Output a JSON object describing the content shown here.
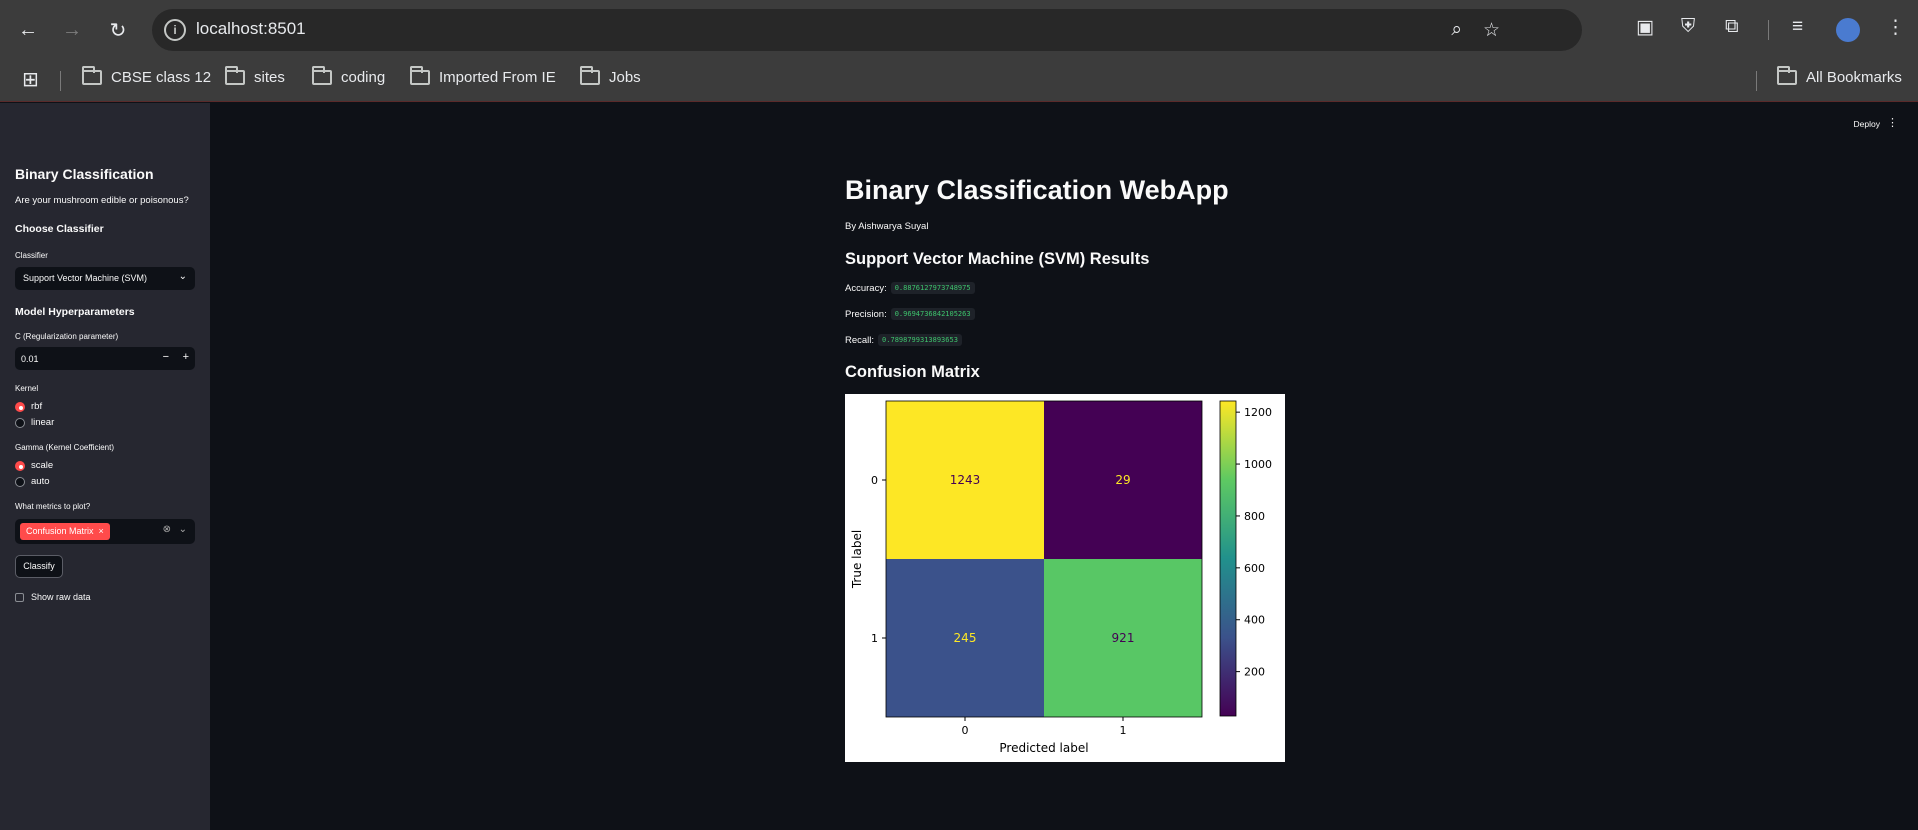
{
  "browser": {
    "url": "localhost:8501",
    "bookmarks": [
      "CBSE class 12",
      "sites",
      "coding",
      "Imported From IE",
      "Jobs"
    ],
    "all_bookmarks_label": "All Bookmarks"
  },
  "header": {
    "deploy_label": "Deploy",
    "menu_icon": "kebab-icon"
  },
  "sidebar": {
    "title": "Binary Classification",
    "subtitle": "Are your mushroom edible or poisonous?",
    "choose_heading": "Choose Classifier",
    "classifier_label": "Classifier",
    "classifier_value": "Support Vector Machine (SVM)",
    "hyper_heading": "Model Hyperparameters",
    "c_label": "C (Regularization parameter)",
    "c_value": "0.01",
    "step_minus": "−",
    "step_plus": "+",
    "kernel_label": "Kernel",
    "kernel_options": [
      "rbf",
      "linear"
    ],
    "kernel_selected": "rbf",
    "gamma_label": "Gamma (Kernel Coefficient)",
    "gamma_options": [
      "scale",
      "auto"
    ],
    "gamma_selected": "scale",
    "metrics_label": "What metrics to plot?",
    "metrics_selected": [
      "Confusion Matrix"
    ],
    "tag_remove": "×",
    "classify_label": "Classify",
    "raw_data_label": "Show raw data"
  },
  "main": {
    "title": "Binary Classification WebApp",
    "author": "By Aishwarya Suyal",
    "results_heading": "Support Vector Machine (SVM) Results",
    "accuracy_label": "Accuracy:",
    "accuracy_value": "0.8876127973748975",
    "precision_label": "Precision:",
    "precision_value": "0.9694736842105263",
    "recall_label": "Recall:",
    "recall_value": "0.7898799313893653",
    "cm_heading": "Confusion Matrix"
  },
  "chart_data": {
    "type": "heatmap",
    "title": "",
    "xlabel": "Predicted label",
    "ylabel": "True label",
    "x_categories": [
      "0",
      "1"
    ],
    "y_categories": [
      "0",
      "1"
    ],
    "values": [
      [
        1243,
        29
      ],
      [
        245,
        921
      ]
    ],
    "colormap": "viridis",
    "colorbar_ticks": [
      200,
      400,
      600,
      800,
      1000,
      1200
    ],
    "cell_colors": [
      [
        "#fde725",
        "#440154"
      ],
      [
        "#3b528b",
        "#58c765"
      ]
    ],
    "cell_text_colors": [
      [
        "#440154",
        "#fde725"
      ],
      [
        "#fde725",
        "#440154"
      ]
    ]
  },
  "colors": {
    "accent": "#ff4b4b",
    "background": "#0e1117",
    "sidebar": "#262730"
  }
}
